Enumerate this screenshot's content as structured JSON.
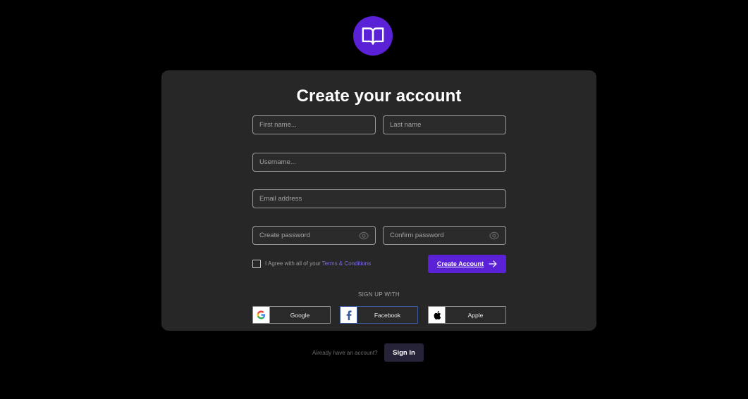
{
  "logo": {
    "icon": "book-icon",
    "color": "#5b21d6"
  },
  "form": {
    "title": "Create your account",
    "first_name_placeholder": "First name...",
    "last_name_placeholder": "Last name",
    "username_placeholder": "Username...",
    "email_placeholder": "Email address",
    "password_placeholder": "Create password",
    "confirm_password_placeholder": "Confirm password",
    "agree_text": "I Agree with all of your",
    "terms_link": "Terms & Conditions",
    "submit_label": "Create Account",
    "accent_color": "#5b21d6"
  },
  "signup_with": {
    "heading": "SIGN UP WITH",
    "providers": [
      {
        "label": "Google",
        "icon": "google-icon"
      },
      {
        "label": "Facebook",
        "icon": "facebook-icon"
      },
      {
        "label": "Apple",
        "icon": "apple-icon"
      }
    ]
  },
  "footer": {
    "prompt": "Already have an account?",
    "signin_label": "Sign In"
  }
}
